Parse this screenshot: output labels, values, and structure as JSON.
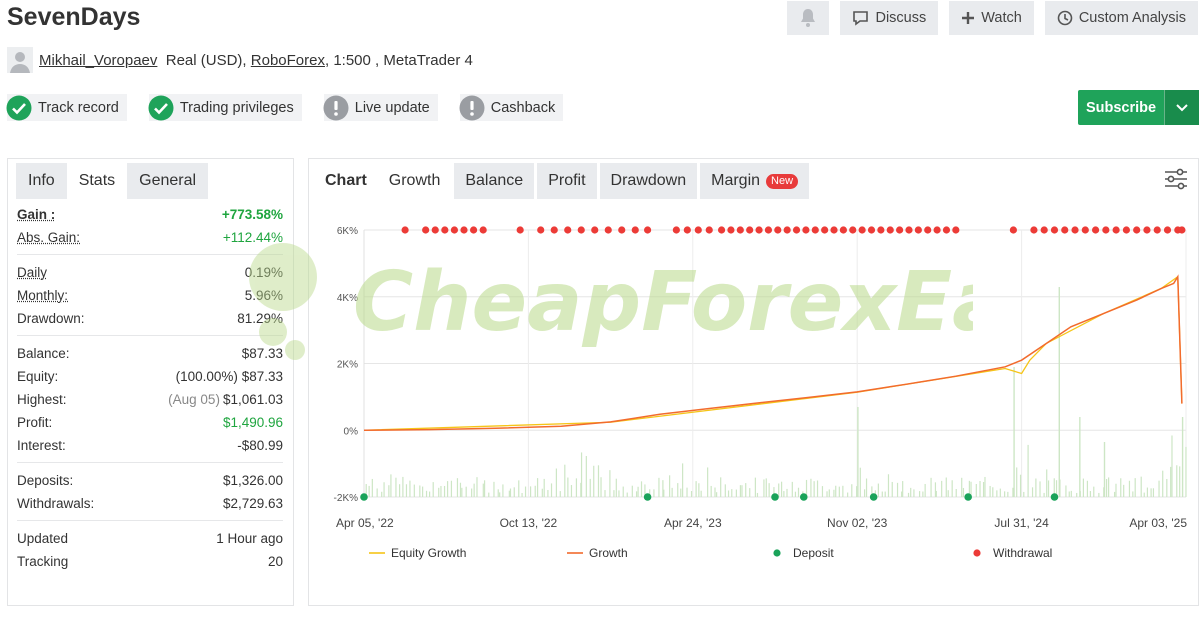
{
  "header": {
    "title": "SevenDays",
    "discuss_label": "Discuss",
    "watch_label": "Watch",
    "analysis_label": "Custom Analysis"
  },
  "owner": {
    "name": "Mikhail_Voropaev",
    "account": "Real (USD),",
    "broker": "RoboForex",
    "details": ", 1:500 , MetaTrader 4"
  },
  "badges": [
    {
      "label": "Track record",
      "status": "ok"
    },
    {
      "label": "Trading privileges",
      "status": "ok"
    },
    {
      "label": "Live update",
      "status": "warn"
    },
    {
      "label": "Cashback",
      "status": "warn"
    }
  ],
  "subscribe": {
    "label": "Subscribe"
  },
  "left_tabs": [
    "Info",
    "Stats",
    "General"
  ],
  "stats": {
    "gain_label": "Gain :",
    "gain": "+773.58%",
    "abs_gain_label": "Abs. Gain:",
    "abs_gain": "+112.44%",
    "daily_label": "Daily",
    "daily": "0.19%",
    "monthly_label": "Monthly:",
    "monthly": "5.96%",
    "drawdown_label": "Drawdown:",
    "drawdown": "81.29%",
    "balance_label": "Balance:",
    "balance": "$87.33",
    "equity_label": "Equity:",
    "equity_pct": "(100.00%)",
    "equity": "$87.33",
    "highest_label": "Highest:",
    "highest_date": "(Aug 05)",
    "highest": "$1,061.03",
    "profit_label": "Profit:",
    "profit": "$1,490.96",
    "interest_label": "Interest:",
    "interest": "-$80.99",
    "deposits_label": "Deposits:",
    "deposits": "$1,326.00",
    "withdrawals_label": "Withdrawals:",
    "withdrawals": "$2,729.63",
    "updated_label": "Updated",
    "updated": "1 Hour ago",
    "tracking_label": "Tracking",
    "tracking": "20"
  },
  "chart_tabs": {
    "head": "Chart",
    "growth": "Growth",
    "balance": "Balance",
    "profit": "Profit",
    "drawdown": "Drawdown",
    "margin": "Margin",
    "new_tag": "New"
  },
  "watermark": {
    "text": "CheapForexEa"
  },
  "colors": {
    "green": "#1fa35a",
    "growth_line": "#f26b2d",
    "equity_line": "#f5c518",
    "deposit_dot": "#1aa35a",
    "withdrawal_dot": "#ec3b37",
    "bars": "#cde6c5"
  },
  "chart_data": {
    "type": "line",
    "x_tick_labels": [
      "Apr 05, '22",
      "Oct 13, '22",
      "Apr 24, '23",
      "Nov 02, '23",
      "Jul 31, '24",
      "Apr 03, '25"
    ],
    "y_tick_labels": [
      "6K%",
      "4K%",
      "2K%",
      "0%",
      "-2K%"
    ],
    "ylim": [
      -2000,
      6000
    ],
    "legend": [
      "Equity Growth",
      "Growth",
      "Deposit",
      "Withdrawal"
    ],
    "legend_position": "bottom",
    "series": [
      {
        "name": "Growth",
        "x": [
          0,
          0.08,
          0.16,
          0.24,
          0.3,
          0.36,
          0.42,
          0.48,
          0.54,
          0.6,
          0.66,
          0.72,
          0.78,
          0.8,
          0.83,
          0.86,
          0.9,
          0.94,
          0.97,
          0.985,
          0.99,
          0.995
        ],
        "y": [
          0,
          20,
          60,
          120,
          250,
          480,
          650,
          820,
          980,
          1150,
          1380,
          1620,
          1900,
          2100,
          2600,
          3100,
          3500,
          3900,
          4250,
          4400,
          4600,
          800
        ]
      },
      {
        "name": "Equity Growth",
        "x": [
          0,
          0.3,
          0.6,
          0.78,
          0.8,
          0.81,
          0.83,
          0.9,
          0.97,
          0.99,
          0.995
        ],
        "y": [
          0,
          240,
          1140,
          1850,
          1700,
          2100,
          2600,
          3500,
          4250,
          4600,
          800
        ]
      }
    ],
    "deposit_x": [
      0,
      0.345,
      0.5,
      0.535,
      0.62,
      0.735,
      0.84
    ]
  }
}
